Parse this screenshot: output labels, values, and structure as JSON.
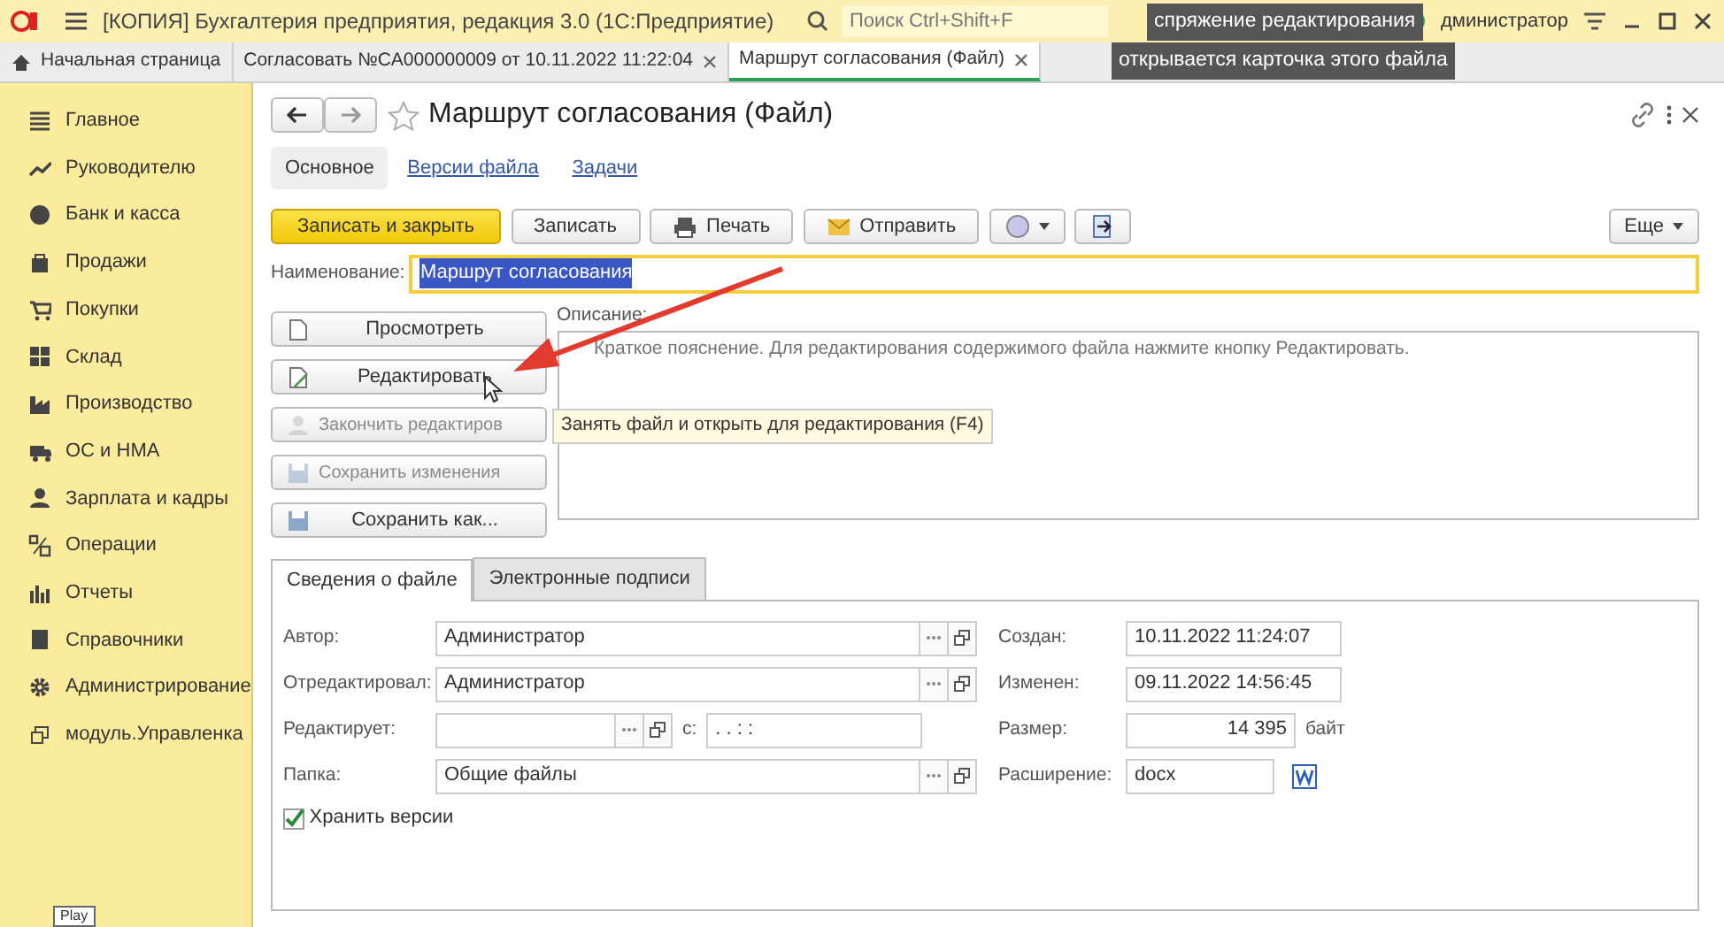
{
  "window": {
    "title": "[КОПИЯ] Бухгалтерия предприятия, редакция 3.0  (1С:Предприятие)",
    "search_placeholder": "Поиск Ctrl+Shift+F",
    "user": "дминистратор"
  },
  "captions": [
    "спряжение редактирования",
    "открывается карточка этого файла"
  ],
  "open_tabs": [
    {
      "label": "Начальная страница",
      "kind": "home",
      "selected": false
    },
    {
      "label": "Согласовать №CA000000009 от 10.11.2022 11:22:04",
      "kind": "closable",
      "selected": false
    },
    {
      "label": "Маршрут согласования (Файл)",
      "kind": "closable",
      "selected": true
    }
  ],
  "sidebar": {
    "items": [
      {
        "label": "Главное",
        "kind": "lines"
      },
      {
        "label": "Руководителю",
        "kind": "trend"
      },
      {
        "label": "Банк и касса",
        "kind": "coin"
      },
      {
        "label": "Продажи",
        "kind": "bag"
      },
      {
        "label": "Покупки",
        "kind": "cart"
      },
      {
        "label": "Склад",
        "kind": "grid"
      },
      {
        "label": "Производство",
        "kind": "factory"
      },
      {
        "label": "ОС и НМА",
        "kind": "truck"
      },
      {
        "label": "Зарплата и кадры",
        "kind": "person"
      },
      {
        "label": "Операции",
        "kind": "dtkt"
      },
      {
        "label": "Отчеты",
        "kind": "bars"
      },
      {
        "label": "Справочники",
        "kind": "book"
      },
      {
        "label": "Администрирование",
        "kind": "gear"
      },
      {
        "label": "модуль.Управленка",
        "kind": "window"
      }
    ]
  },
  "form": {
    "title": "Маршрут согласования (Файл)",
    "sections": [
      {
        "label": "Основное",
        "selected": true
      },
      {
        "label": "Версии файла",
        "selected": false
      },
      {
        "label": "Задачи",
        "selected": false
      }
    ],
    "toolbar": [
      {
        "label": "Записать и закрыть",
        "kind": "primary"
      },
      {
        "label": "Записать",
        "kind": "plain"
      },
      {
        "label": "Печать",
        "kind": "print"
      },
      {
        "label": "Отправить",
        "kind": "mail"
      },
      {
        "kind": "circle-menu"
      },
      {
        "kind": "export"
      }
    ],
    "more": "Еще",
    "name_label": "Наименование:",
    "name_value": "Маршрут согласования",
    "file_buttons": [
      {
        "label": "Просмотреть",
        "kind": "page",
        "disabled": false
      },
      {
        "label": "Редактировать",
        "kind": "pencil",
        "disabled": false
      },
      {
        "label": "Закончить редактиров",
        "kind": "person",
        "disabled": true
      },
      {
        "label": "Сохранить изменения",
        "kind": "save",
        "disabled": true
      },
      {
        "label": "Сохранить как...",
        "kind": "save",
        "disabled": false
      }
    ],
    "description_label": "Описание:",
    "description_placeholder": "Краткое пояснение. Для редактирования содержимого файла нажмите кнопку Редактировать.",
    "tooltip": "Занять файл и открыть для редактирования (F4)",
    "info_tabs": [
      {
        "label": "Сведения о файле",
        "selected": true
      },
      {
        "label": "Электронные подписи",
        "selected": false
      }
    ],
    "info_rows": [
      {
        "label": "Автор:",
        "value": "Администратор",
        "aside_label": "Создан:",
        "aside_value": "10.11.2022 11:24:07",
        "kind": "date"
      },
      {
        "label": "Отредактировал:",
        "value": "Администратор",
        "aside_label": "Изменен:",
        "aside_value": "09.11.2022 14:56:45",
        "kind": "date"
      },
      {
        "label": "Редактирует:",
        "since_label": "с:",
        "since_value": ". .     :  :",
        "aside_label": "Размер:",
        "aside_value": "14 395",
        "aside_unit": "байт",
        "kind": "size"
      },
      {
        "label": "Папка:",
        "value": "Общие файлы",
        "aside_label": "Расширение:",
        "aside_value": "docx",
        "kind": "extension"
      }
    ],
    "keep_versions": {
      "label": "Хранить версии",
      "checked": true
    }
  },
  "player_tooltip": "Play"
}
